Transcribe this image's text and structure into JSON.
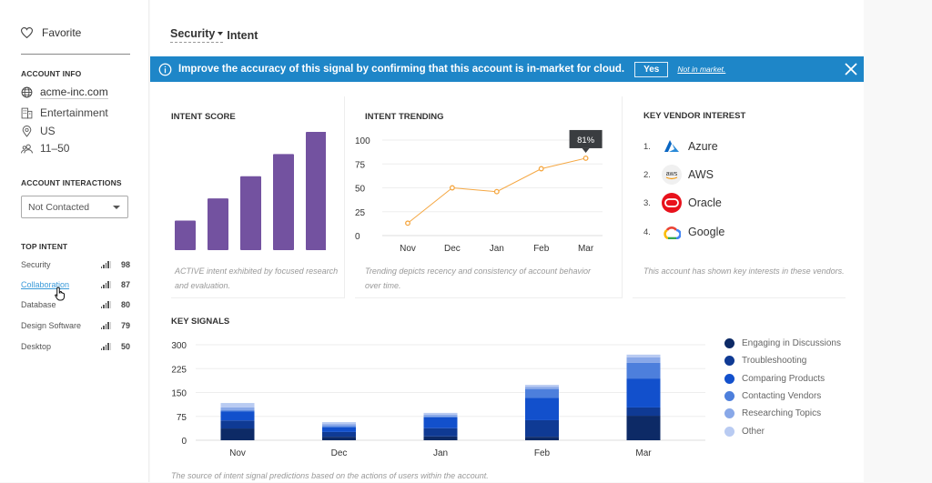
{
  "sidebar": {
    "favorite_label": "Favorite",
    "account_info_heading": "ACCOUNT INFO",
    "account_info": {
      "domain": "acme-inc.com",
      "industry": "Entertainment",
      "location": "US",
      "employees": "11–50"
    },
    "account_interactions_heading": "ACCOUNT INTERACTIONS",
    "interaction_status": "Not Contacted",
    "top_intent_heading": "TOP INTENT",
    "top_intent": [
      {
        "label": "Security",
        "score": "98",
        "hovered": false
      },
      {
        "label": "Collaboration",
        "score": "87",
        "hovered": true
      },
      {
        "label": "Database",
        "score": "80",
        "hovered": false
      },
      {
        "label": "Design Software",
        "score": "79",
        "hovered": false
      },
      {
        "label": "Desktop",
        "score": "50",
        "hovered": false
      }
    ]
  },
  "header": {
    "topic": "Security",
    "suffix": "Intent"
  },
  "banner": {
    "message": "Improve the accuracy of this signal by confirming that this account is in-market for cloud.",
    "yes_label": "Yes",
    "not_in_market_label": "Not in market.",
    "color": "#1e86c8"
  },
  "intent_score": {
    "heading": "INTENT SCORE",
    "caption": "ACTIVE intent exhibited by focused research and evaluation.",
    "levels_active": 5,
    "levels_total": 5,
    "color": "#7352a0"
  },
  "vendor_interest": {
    "heading": "KEY VENDOR INTEREST",
    "vendors": [
      {
        "rank": "1.",
        "name": "Azure",
        "icon": "azure-logo-icon"
      },
      {
        "rank": "2.",
        "name": "AWS",
        "icon": "aws-logo-icon"
      },
      {
        "rank": "3.",
        "name": "Oracle",
        "icon": "oracle-logo-icon"
      },
      {
        "rank": "4.",
        "name": "Google",
        "icon": "google-cloud-logo-icon"
      }
    ],
    "caption": "This account has shown key interests in these vendors."
  },
  "chart_data": [
    {
      "type": "line",
      "title": "INTENT TRENDING",
      "categories": [
        "Nov",
        "Dec",
        "Jan",
        "Feb",
        "Mar"
      ],
      "values": [
        13,
        50,
        46,
        70,
        81
      ],
      "ylim": [
        0,
        100
      ],
      "yticks": [
        0,
        25,
        50,
        75,
        100
      ],
      "grid": true,
      "tooltip": {
        "category": "Mar",
        "label": "81%"
      },
      "color": "#f5a742",
      "caption": "Trending depicts recency and consistency of account behavior over time."
    },
    {
      "type": "bar",
      "stacked": true,
      "title": "KEY SIGNALS",
      "categories": [
        "Nov",
        "Dec",
        "Jan",
        "Feb",
        "Mar"
      ],
      "ylim": [
        0,
        300
      ],
      "yticks": [
        0,
        75,
        150,
        225,
        300
      ],
      "grid": true,
      "legend_position": "right",
      "series": [
        {
          "name": "Engaging in Discussions",
          "color": "#0d2a66",
          "values": [
            37,
            11,
            12,
            11,
            77
          ]
        },
        {
          "name": "Troubleshooting",
          "color": "#0f3a94",
          "values": [
            25,
            15,
            26,
            52,
            26
          ]
        },
        {
          "name": "Comparing Products",
          "color": "#1250cc",
          "values": [
            28,
            14,
            34,
            70,
            91
          ]
        },
        {
          "name": "Contacting Vendors",
          "color": "#4d7fdc",
          "values": [
            4,
            5,
            3,
            28,
            49
          ]
        },
        {
          "name": "Researching Topics",
          "color": "#89a8e8",
          "values": [
            9,
            6,
            5,
            7,
            17
          ]
        },
        {
          "name": "Other",
          "color": "#b9cbf2",
          "values": [
            14,
            6,
            6,
            6,
            9
          ]
        }
      ],
      "caption": "The source of intent signal predictions based on the actions of users within the account."
    }
  ]
}
